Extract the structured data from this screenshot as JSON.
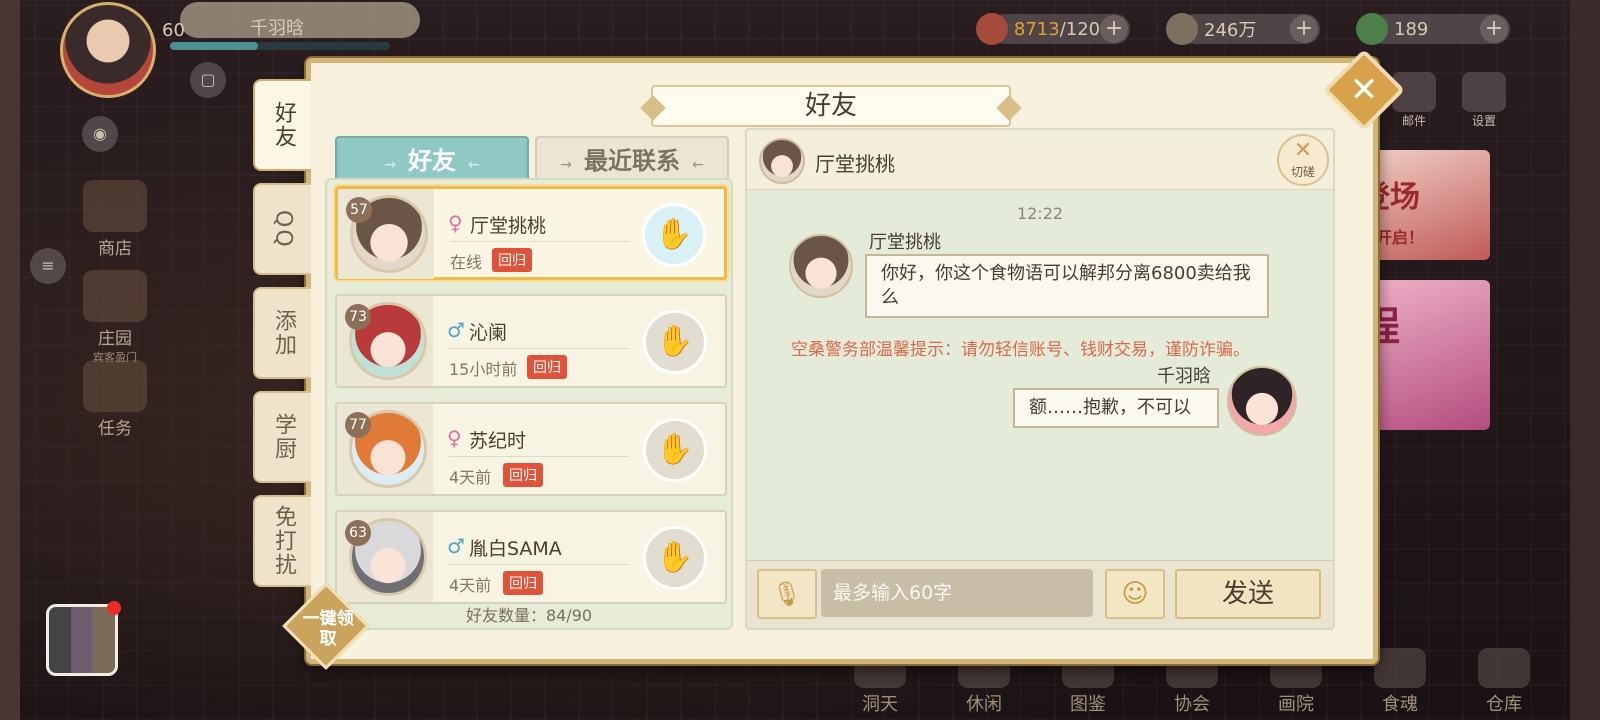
{
  "hud": {
    "player_level": "60",
    "player_name": "千羽晗",
    "food_used": "8713",
    "food_total": "/120",
    "coins": "246万",
    "jade": "189",
    "plus": "+"
  },
  "left_menu": {
    "shop": "商店",
    "manor": "庄园",
    "manor_sub": "宾客盈门",
    "tasks": "任务"
  },
  "right_bg": {
    "mail": "邮件",
    "settings": "设置",
    "banner1": "登场",
    "banner1_sub": "你开启！",
    "banner2": "程"
  },
  "bottom_bar": [
    "洞天",
    "休闲",
    "图鉴",
    "协会",
    "画院",
    "食魂",
    "仓库"
  ],
  "dialog": {
    "title": "好友",
    "close": "✕",
    "side_tabs": [
      "好友",
      "QQ",
      "添加",
      "学厨",
      "免打扰"
    ],
    "tab_friends": "好友",
    "tab_recent": "最近联系",
    "tab_deco_left": "→",
    "tab_deco_right": "←",
    "friends": [
      {
        "level": "57",
        "gender": "♀",
        "name": "厅堂挑桃",
        "status": "在线",
        "badge": "回归"
      },
      {
        "level": "73",
        "gender": "♂",
        "name": "沁阑",
        "status": "15小时前",
        "badge": "回归"
      },
      {
        "level": "77",
        "gender": "♀",
        "name": "苏纪时",
        "status": "4天前",
        "badge": "回归"
      },
      {
        "level": "63",
        "gender": "♂",
        "name": "胤白SAMA",
        "status": "4天前",
        "badge": "回归"
      }
    ],
    "friend_count": "好友数量：84/90",
    "claim_all": "一键领取"
  },
  "chat": {
    "partner_name": "厅堂挑桃",
    "cut_label": "切磋",
    "time": "12:22",
    "incoming_sender": "厅堂挑桃",
    "incoming_text": "你好，你这个食物语可以解邦分离6800卖给我么",
    "warning": "空桑警务部温馨提示：请勿轻信账号、钱财交易，谨防诈骗。",
    "outgoing_sender": "千羽晗",
    "outgoing_text": "额……抱歉，不可以",
    "input_placeholder": "最多输入60字",
    "send": "发送"
  },
  "icons": {
    "mic": "mic-icon",
    "emoji": "cat-face-icon",
    "handshake": "handshake-icon",
    "cut": "crossed-swords-icon"
  },
  "colors": {
    "accent_teal": "#8fc8c4",
    "badge_red": "#e0533b",
    "warning_text": "#d9694a",
    "selected_border": "#f0b94a"
  }
}
